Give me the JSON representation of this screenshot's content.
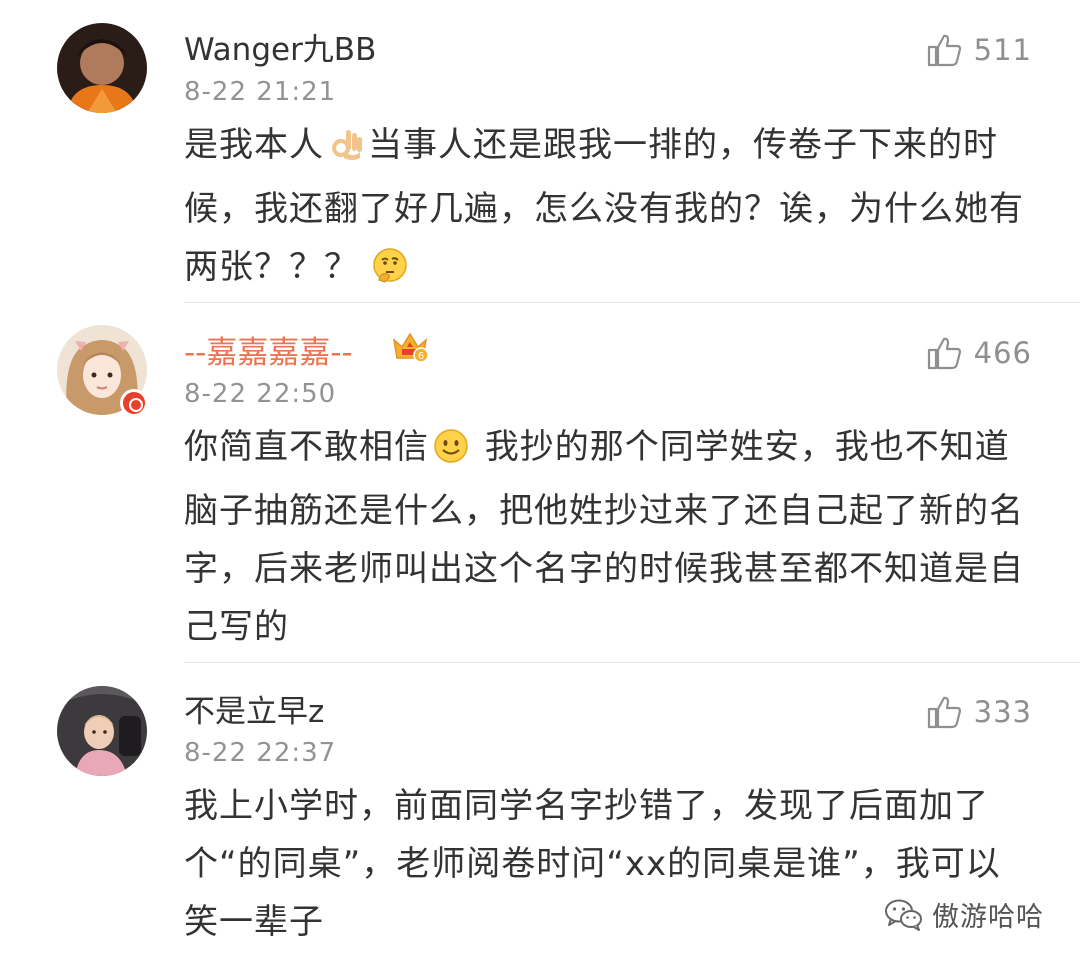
{
  "comments": [
    {
      "username": "Wanger九BB",
      "timestamp": "8-22 21:21",
      "likes": "511",
      "text_before_emoji": "是我本人",
      "emoji_1": "ok-hand-emoji",
      "text_after_emoji": "当事人还是跟我一排的，传卷子下来的时候，我还翻了好几遍，怎么没有我的？诶，为什么她有两张？？？",
      "emoji_2": "thinking-face-emoji",
      "verified": false,
      "vip": false
    },
    {
      "username": "--嘉嘉嘉嘉--",
      "timestamp": "8-22 22:50",
      "likes": "466",
      "text_before_emoji": "你简直不敢相信",
      "emoji_1": "smiling-face-emoji",
      "text_after_emoji": " 我抄的那个同学姓安，我也不知道脑子抽筋还是什么，把他姓抄过来了还自己起了新的名字，后来老师叫出这个名字的时候我甚至都不知道是自己写的",
      "verified": true,
      "vip": true,
      "vip_level": "6"
    },
    {
      "username": "不是立早z",
      "timestamp": "8-22 22:37",
      "likes": "333",
      "text": "我上小学时，前面同学名字抄错了，发现了后面加了个“的同桌”，老师阅卷时问“xx的同桌是谁”，我可以笑一辈子",
      "verified": false,
      "vip": false
    }
  ],
  "watermark": {
    "text": "傲游哈哈",
    "icon": "wechat-icon"
  },
  "colors": {
    "text": "#333333",
    "meta": "#939393",
    "vip_name": "#eb7350",
    "like": "#8f8f8f",
    "divider": "#e6e6e6"
  }
}
